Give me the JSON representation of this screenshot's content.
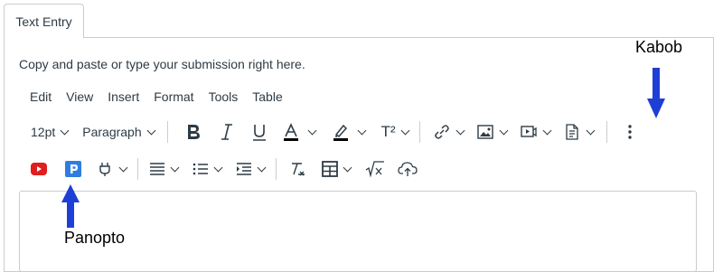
{
  "tab": {
    "label": "Text Entry"
  },
  "prompt": "Copy and paste or type your submission right here.",
  "menu": [
    "Edit",
    "View",
    "Insert",
    "Format",
    "Tools",
    "Table"
  ],
  "toolbar": {
    "font_size": "12pt",
    "block_format": "Paragraph",
    "superscript_label": "T²"
  },
  "annotations": {
    "kabob": "Kabob",
    "panopto": "Panopto"
  },
  "colors": {
    "arrow": "#1d3fd6",
    "youtube": "#e01e1e",
    "panopto": "#2f7de1",
    "text": "#2d3b45",
    "border": "#c7cdd1"
  },
  "icons": {
    "bold": "bold-icon",
    "italic": "italic-icon",
    "underline": "underline-icon",
    "text_color": "text-color-icon",
    "highlight": "highlight-icon",
    "superscript": "superscript-icon",
    "link": "link-icon",
    "image": "image-icon",
    "media": "media-icon",
    "document": "document-icon",
    "kebab": "kebab-menu-icon",
    "youtube": "youtube-icon",
    "panopto": "panopto-icon",
    "plugin": "plugin-icon",
    "align": "align-icon",
    "list": "list-icon",
    "indent": "indent-icon",
    "clear_format": "clear-formatting-icon",
    "table": "table-icon",
    "equation": "equation-icon",
    "upload": "cloud-upload-icon"
  }
}
